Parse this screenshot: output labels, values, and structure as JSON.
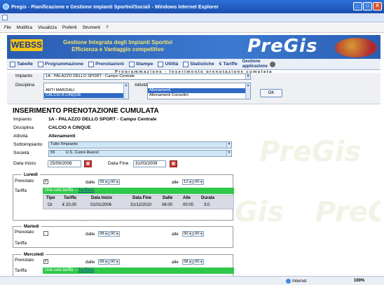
{
  "window": {
    "title": "Pregis - Pianificazione e Gestione Impianti Sportivi/Sociali - Windows Internet Explorer",
    "close": "X",
    "minimize": "_",
    "restore": "□"
  },
  "menu": [
    "File",
    "Modifica",
    "Visualizza",
    "Preferiti",
    "Strumenti",
    "?"
  ],
  "banner": {
    "logo": "WEBSS",
    "tagline_line1": "Gestione Integrata degli Impianti Sportivi",
    "tagline_line2": "Efficienza e Vantaggio competitivo",
    "brand": "PreGis"
  },
  "toolbar": {
    "tabelle": "Tabelle",
    "programmazione": "Programmazione",
    "prenotazioni": "Prenotazioni",
    "stampe": "Stampe",
    "utilita": "Utilità",
    "statistiche": "Statistiche",
    "tariffe": "Tariffe",
    "gestione_line1": "Gestione",
    "gestione_line2": "applicazione"
  },
  "subheader": "Programmazione - Inserimento prenotazione cumulata",
  "filters": {
    "impianto_label": "Impianto",
    "impianto_value": "1A - PALAZZO DELLO SPORT - Campo Centrale",
    "disciplina_label": "Disciplina",
    "disciplina_options": [
      "",
      "ARTI MARZIALI",
      "CALCIO A CINQUE"
    ],
    "attivita_label": "Attività",
    "attivita_options": [
      "",
      "Allenamenti",
      "Allenamenti Consolini"
    ],
    "ok": "OK"
  },
  "form": {
    "title": "INSERIMENTO PRENOTAZIONE CUMULATA",
    "impianto_label": "Impianto",
    "impianto": "1A - PALAZZO DELLO SPORT - Campo Centrale",
    "disciplina_label": "Disciplina",
    "disciplina": "CALCIO A CINQUE",
    "attivita_label": "Attività",
    "attivita": "Allenamenti",
    "sottoimpianto_label": "Sottoimpianto",
    "sottoimpianto": "Tutto l'impianto",
    "societa_label": "Società",
    "societa_code": "55",
    "societa_name": "U.S. Cuore Avanzi",
    "data_inizio_label": "Data Inizio",
    "data_inizio": "25/09/2008",
    "data_fine_label": "Data Fine",
    "data_fine": "31/03/2009"
  },
  "days": [
    {
      "name": "Lunedì",
      "prenotato_label": "Prenotato",
      "checked": "✔",
      "dalle_label": "dalle",
      "dalle_h": "09",
      "dalle_m": "00",
      "alle_label": "alle",
      "alle_h": "12",
      "alle_m": "00",
      "tariffa_label": "Tariffa",
      "tariffa_text": "Una sola tariffa --",
      "tariffa_link": "Tariffario",
      "table_headers": [
        "Tipo",
        "Tariffa",
        "Data Inizio",
        "Data Fine",
        "Dalle",
        "Alle",
        "Durata"
      ],
      "table_row": [
        "Or",
        "€ 20,00",
        "01/01/2006",
        "31/12/2010",
        "06:00",
        "00:00",
        "3:0"
      ]
    },
    {
      "name": "Martedì",
      "prenotato_label": "Prenotato",
      "checked": "",
      "dalle_label": "dalle",
      "dalle_h": "08",
      "dalle_m": "00",
      "alle_label": "alle",
      "alle_h": "00",
      "alle_m": "00",
      "tariffa_label": "Tariffa"
    },
    {
      "name": "Mercoledì",
      "prenotato_label": "Prenotato",
      "checked": "✔",
      "dalle_label": "dalle",
      "dalle_h": "08",
      "dalle_m": "00",
      "alle_label": "alle",
      "alle_h": "08",
      "alle_m": "00",
      "tariffa_label": "Tariffa",
      "tariffa_text": "Una sola tariffa --",
      "tariffa_link": "Tariffario"
    }
  ],
  "status": {
    "zone": "Internet",
    "zoom": "100%"
  },
  "colors": {
    "accent": "#2a5db2",
    "green": "#2fc84a",
    "selection": "#316ac5"
  }
}
